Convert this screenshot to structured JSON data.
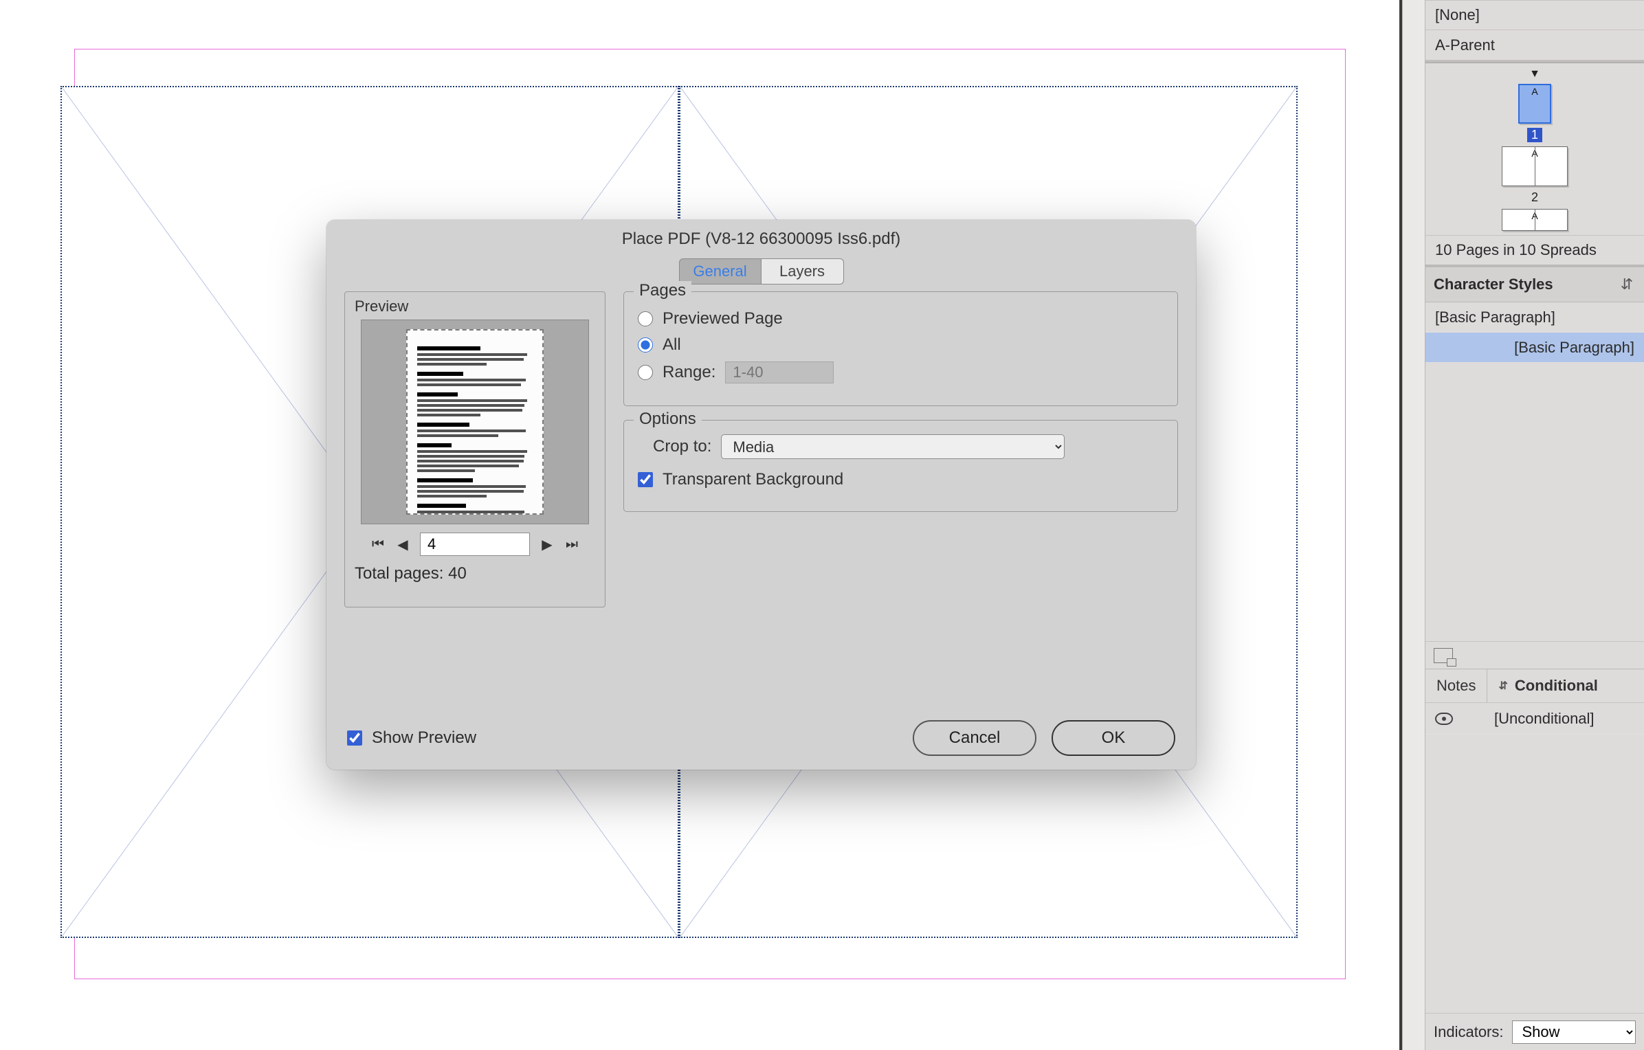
{
  "dialog": {
    "title": "Place PDF (V8-12 66300095 Iss6.pdf)",
    "tabs": {
      "general": "General",
      "layers": "Layers"
    },
    "preview": {
      "label": "Preview",
      "page_value": "4",
      "total_label": "Total pages: 40"
    },
    "pages_group": {
      "legend": "Pages",
      "opt_previewed": "Previewed Page",
      "opt_all": "All",
      "opt_range": "Range:",
      "range_placeholder": "1-40"
    },
    "options_group": {
      "legend": "Options",
      "crop_label": "Crop to:",
      "crop_value": "Media",
      "transparent": "Transparent Background"
    },
    "show_preview": "Show Preview",
    "cancel": "Cancel",
    "ok": "OK"
  },
  "panels": {
    "none_row": "[None]",
    "parent_row": "A-Parent",
    "page1_label": "1",
    "page2_label": "2",
    "master_a": "A",
    "pages_summary": "10 Pages in 10 Spreads",
    "char_styles_title": "Character Styles",
    "basic_paragraph": "[Basic Paragraph]",
    "notes_tab": "Notes",
    "conditional_tab": "Conditional",
    "unconditional": "[Unconditional]",
    "indicators_label": "Indicators:",
    "indicators_value": "Show"
  }
}
